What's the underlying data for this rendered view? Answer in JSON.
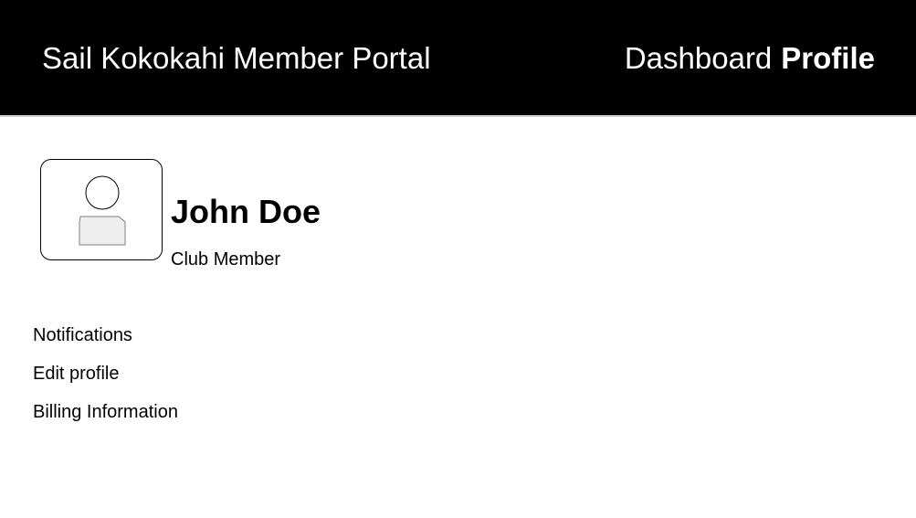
{
  "header": {
    "title": "Sail Kokokahi Member Portal",
    "nav": {
      "dashboard": "Dashboard",
      "profile": "Profile",
      "active": "profile"
    }
  },
  "profile": {
    "avatar_icon": "user-placeholder-icon",
    "name": "John Doe",
    "role": "Club Member"
  },
  "menu": {
    "items": [
      {
        "label": "Notifications"
      },
      {
        "label": "Edit profile"
      },
      {
        "label": "Billing Information"
      }
    ]
  },
  "colors": {
    "header_background": "#000000",
    "header_text": "#ffffff",
    "page_background": "#ffffff",
    "text": "#000000"
  }
}
